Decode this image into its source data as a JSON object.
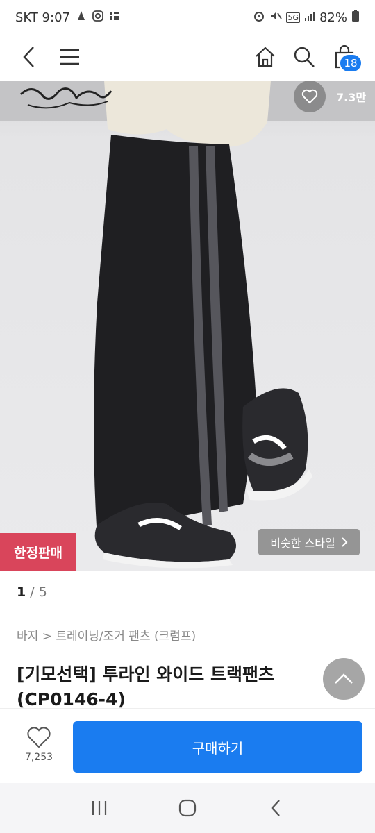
{
  "status": {
    "carrier_time": "SKT 9:07",
    "battery": "82%",
    "network": "5G"
  },
  "nav": {
    "cart_count": "18"
  },
  "hero": {
    "like_count": "7.3만",
    "limited_label": "한정판매",
    "similar_label": "비슷한 스타일"
  },
  "pager": {
    "current": "1",
    "total": "/ 5"
  },
  "breadcrumb": "바지 > 트레이닝/조거 팬츠 (크럼프)",
  "product": {
    "title": "[기모선택] 투라인 와이드 트랙팬츠 (CP0146-4)"
  },
  "bottom": {
    "wish_count": "7,253",
    "buy_label": "구매하기"
  },
  "colors": {
    "accent": "#1a7cf0",
    "limited": "#d9455b"
  }
}
